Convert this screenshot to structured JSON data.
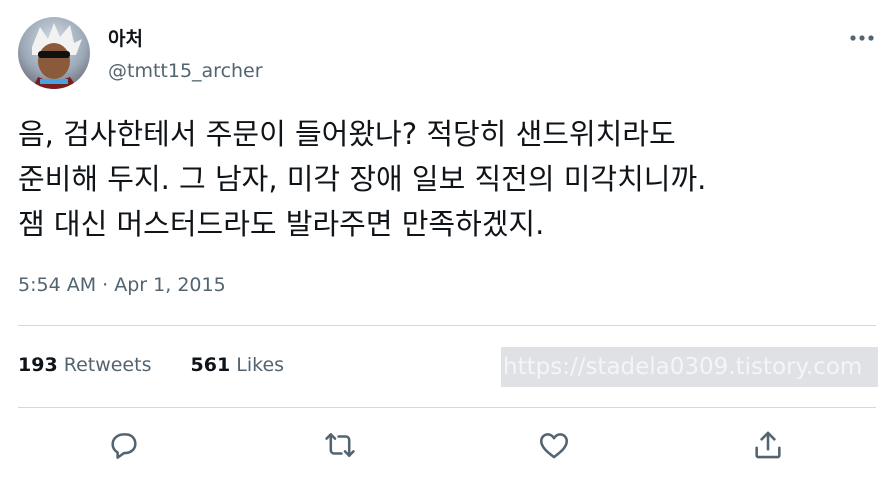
{
  "author": {
    "display_name": "아처",
    "handle": "@tmtt15_archer",
    "avatar_icon": "avatar-archer"
  },
  "tweet": {
    "text": "음, 검사한테서 주문이 들어왔나? 적당히 샌드위치라도\n준비해 두지. 그 남자, 미각 장애 일보 직전의 미각치니까.\n잼 대신 머스터드라도 발라주면 만족하겠지.",
    "time": "5:54 AM",
    "separator": "·",
    "date": "Apr 1, 2015"
  },
  "stats": {
    "retweets_count": "193",
    "retweets_label": "Retweets",
    "likes_count": "561",
    "likes_label": "Likes"
  },
  "watermark": "https://stadela0309.tistory.com",
  "actions": [
    "reply-icon",
    "retweet-icon",
    "like-icon",
    "share-icon"
  ],
  "colors": {
    "text": "#0f1419",
    "secondary": "#536471",
    "divider": "#cfd9de",
    "icon": "#536471"
  }
}
